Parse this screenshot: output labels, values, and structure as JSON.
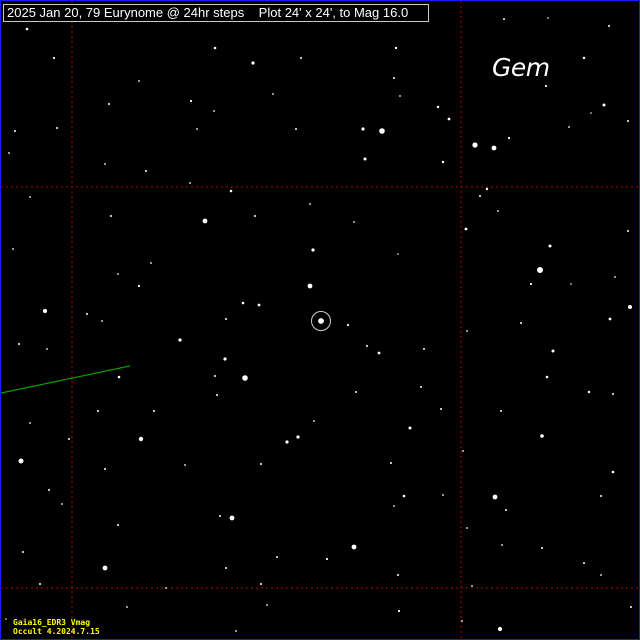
{
  "header": {
    "title": "2025 Jan 20, 79 Eurynome @ 24hr steps    Plot 24' x 24', to Mag 16.0"
  },
  "labels": {
    "constellation": "Gem"
  },
  "footer": {
    "catalog": "Gaia16_EDR3 Vmag",
    "software": "Occult 4.2024.7.15"
  },
  "colors": {
    "background": "#000000",
    "grid": "#b40000",
    "path": "#00a000",
    "stars": "#ffffff",
    "footer_text": "#ffff00",
    "frame": "#1a1aff"
  }
}
